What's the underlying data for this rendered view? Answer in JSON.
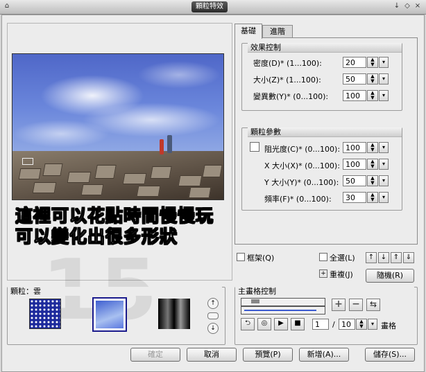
{
  "window": {
    "title": "顆粒特效",
    "controls": [
      "↓",
      "◇",
      "×"
    ]
  },
  "preview": {
    "overlay_line1": "這裡可以花點時間慢慢玩",
    "overlay_line2": "可以變化出很多形狀"
  },
  "tabs": [
    {
      "label": "基礎"
    },
    {
      "label": "進階"
    }
  ],
  "effect_group": {
    "title": "效果控制",
    "rows": [
      {
        "label": "密度(D)* (1...100):",
        "value": "20"
      },
      {
        "label": "大小(Z)* (1...100):",
        "value": "50"
      },
      {
        "label": "變異數(Y)* (0...100):",
        "value": "100"
      }
    ]
  },
  "particle_group": {
    "title": "顆粒參數",
    "rows": [
      {
        "label": "阻光度(C)* (0...100):",
        "value": "100"
      },
      {
        "label": "X 大小(X)* (0...100):",
        "value": "100"
      },
      {
        "label": "Y 大小(Y)* (0...100):",
        "value": "50"
      },
      {
        "label": "頻率(F)* (0...100):",
        "value": "30"
      }
    ]
  },
  "options": {
    "frame": "框架(Q)",
    "select_all": "全選(L)",
    "overlap": "重複(J)",
    "random_button": "隨機(R)"
  },
  "particle_panel": {
    "title": "顆粒：雲"
  },
  "keyframe_panel": {
    "title": "主畫格控制",
    "frame_value": "1",
    "separator": "/",
    "total_frames": "10",
    "frames_label": "畫格"
  },
  "footer_buttons": {
    "ok": "確定",
    "cancel": "取消",
    "preview": "預覽(P)",
    "add": "新增(A)...",
    "save": "儲存(S)..."
  },
  "colors": {
    "title_bar": "#2a2a2a",
    "window_bg": "#ececec",
    "thumb_selected_border": "#1a1a8c",
    "sky_top": "#4f67c8"
  }
}
